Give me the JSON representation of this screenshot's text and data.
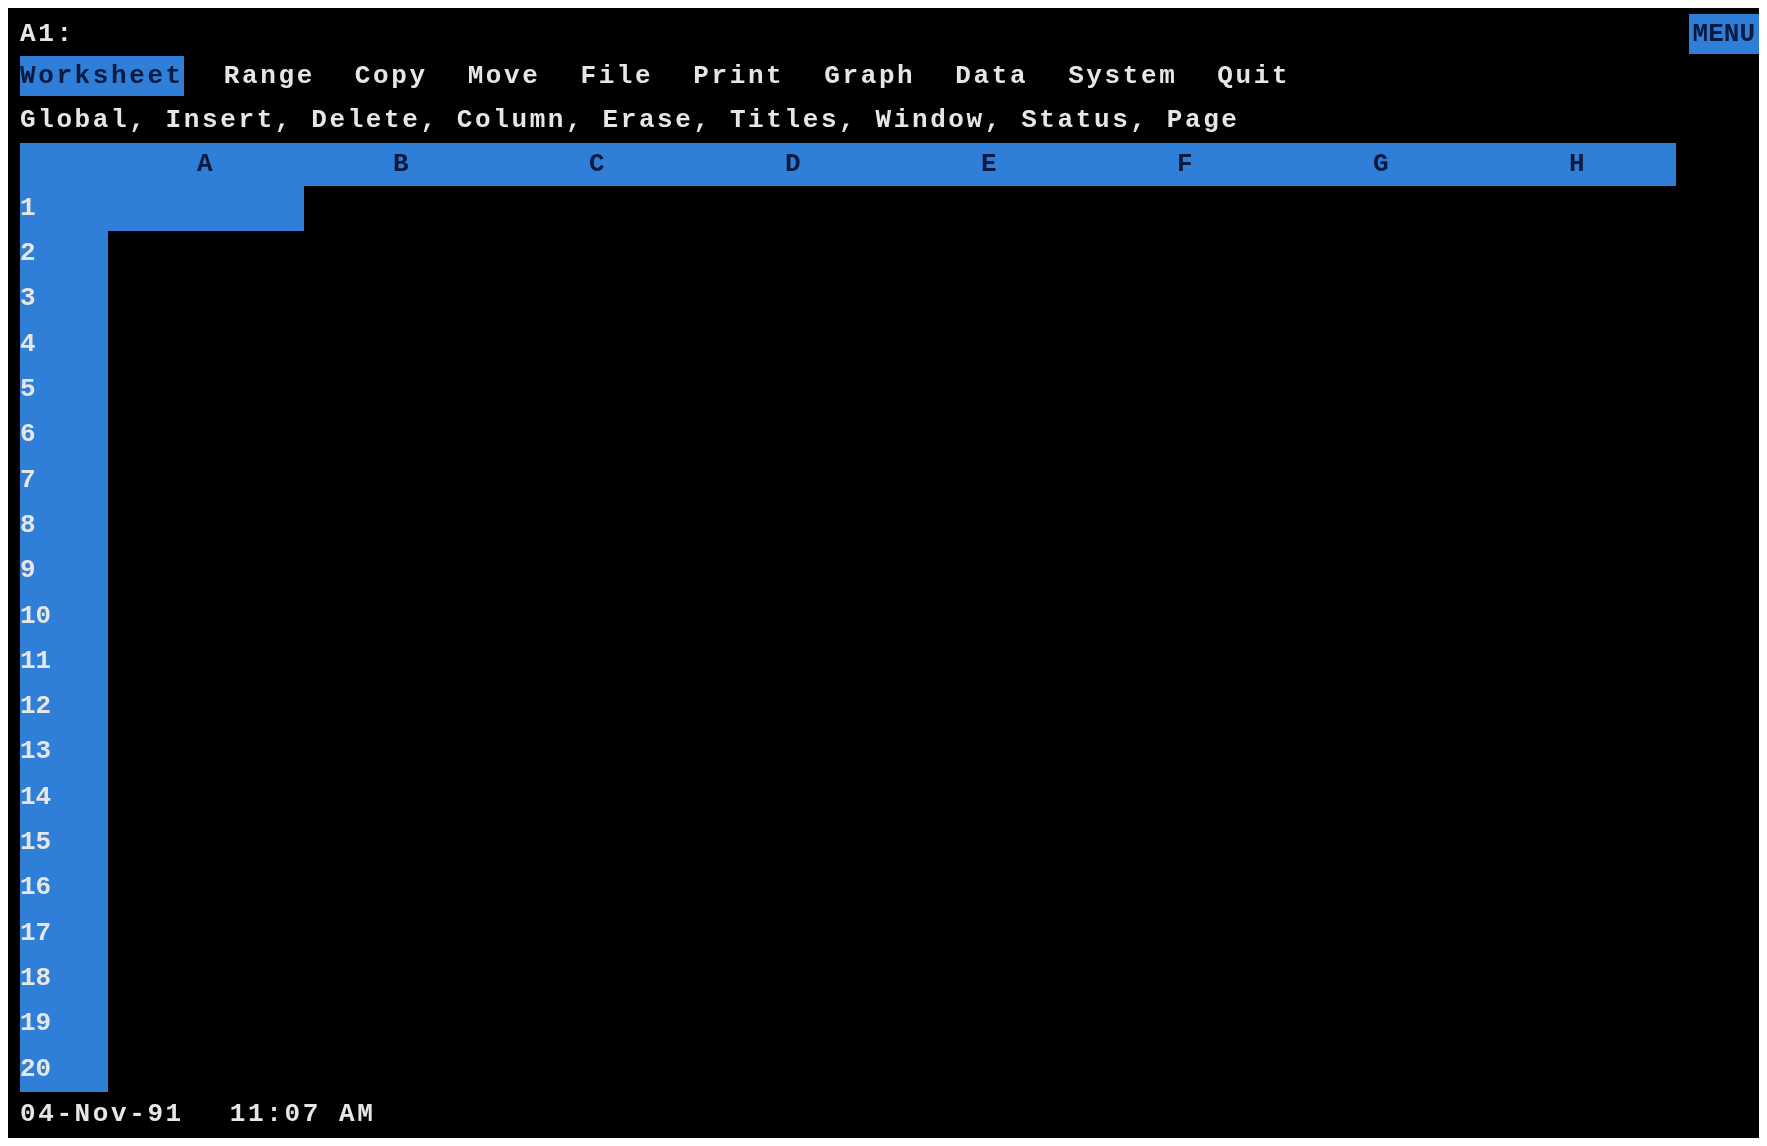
{
  "cell_indicator": "A1:",
  "mode_indicator": "MENU",
  "menu": [
    {
      "label": "Worksheet",
      "selected": true
    },
    {
      "label": "Range",
      "selected": false
    },
    {
      "label": "Copy",
      "selected": false
    },
    {
      "label": "Move",
      "selected": false
    },
    {
      "label": "File",
      "selected": false
    },
    {
      "label": "Print",
      "selected": false
    },
    {
      "label": "Graph",
      "selected": false
    },
    {
      "label": "Data",
      "selected": false
    },
    {
      "label": "System",
      "selected": false
    },
    {
      "label": "Quit",
      "selected": false
    }
  ],
  "menu_description": "Global, Insert, Delete, Column, Erase, Titles, Window, Status, Page",
  "columns": [
    "A",
    "B",
    "C",
    "D",
    "E",
    "F",
    "G",
    "H"
  ],
  "rows": [
    {
      "label": "1",
      "cells": [
        {
          "selected": true
        },
        {
          "selected": false
        },
        {
          "selected": false
        },
        {
          "selected": false
        },
        {
          "selected": false
        },
        {
          "selected": false
        },
        {
          "selected": false
        },
        {
          "selected": false
        }
      ]
    },
    {
      "label": "2",
      "cells": [
        {
          "selected": false
        },
        {
          "selected": false
        },
        {
          "selected": false
        },
        {
          "selected": false
        },
        {
          "selected": false
        },
        {
          "selected": false
        },
        {
          "selected": false
        },
        {
          "selected": false
        }
      ]
    },
    {
      "label": "3",
      "cells": [
        {
          "selected": false
        },
        {
          "selected": false
        },
        {
          "selected": false
        },
        {
          "selected": false
        },
        {
          "selected": false
        },
        {
          "selected": false
        },
        {
          "selected": false
        },
        {
          "selected": false
        }
      ]
    },
    {
      "label": "4",
      "cells": [
        {
          "selected": false
        },
        {
          "selected": false
        },
        {
          "selected": false
        },
        {
          "selected": false
        },
        {
          "selected": false
        },
        {
          "selected": false
        },
        {
          "selected": false
        },
        {
          "selected": false
        }
      ]
    },
    {
      "label": "5",
      "cells": [
        {
          "selected": false
        },
        {
          "selected": false
        },
        {
          "selected": false
        },
        {
          "selected": false
        },
        {
          "selected": false
        },
        {
          "selected": false
        },
        {
          "selected": false
        },
        {
          "selected": false
        }
      ]
    },
    {
      "label": "6",
      "cells": [
        {
          "selected": false
        },
        {
          "selected": false
        },
        {
          "selected": false
        },
        {
          "selected": false
        },
        {
          "selected": false
        },
        {
          "selected": false
        },
        {
          "selected": false
        },
        {
          "selected": false
        }
      ]
    },
    {
      "label": "7",
      "cells": [
        {
          "selected": false
        },
        {
          "selected": false
        },
        {
          "selected": false
        },
        {
          "selected": false
        },
        {
          "selected": false
        },
        {
          "selected": false
        },
        {
          "selected": false
        },
        {
          "selected": false
        }
      ]
    },
    {
      "label": "8",
      "cells": [
        {
          "selected": false
        },
        {
          "selected": false
        },
        {
          "selected": false
        },
        {
          "selected": false
        },
        {
          "selected": false
        },
        {
          "selected": false
        },
        {
          "selected": false
        },
        {
          "selected": false
        }
      ]
    },
    {
      "label": "9",
      "cells": [
        {
          "selected": false
        },
        {
          "selected": false
        },
        {
          "selected": false
        },
        {
          "selected": false
        },
        {
          "selected": false
        },
        {
          "selected": false
        },
        {
          "selected": false
        },
        {
          "selected": false
        }
      ]
    },
    {
      "label": "10",
      "cells": [
        {
          "selected": false
        },
        {
          "selected": false
        },
        {
          "selected": false
        },
        {
          "selected": false
        },
        {
          "selected": false
        },
        {
          "selected": false
        },
        {
          "selected": false
        },
        {
          "selected": false
        }
      ]
    },
    {
      "label": "11",
      "cells": [
        {
          "selected": false
        },
        {
          "selected": false
        },
        {
          "selected": false
        },
        {
          "selected": false
        },
        {
          "selected": false
        },
        {
          "selected": false
        },
        {
          "selected": false
        },
        {
          "selected": false
        }
      ]
    },
    {
      "label": "12",
      "cells": [
        {
          "selected": false
        },
        {
          "selected": false
        },
        {
          "selected": false
        },
        {
          "selected": false
        },
        {
          "selected": false
        },
        {
          "selected": false
        },
        {
          "selected": false
        },
        {
          "selected": false
        }
      ]
    },
    {
      "label": "13",
      "cells": [
        {
          "selected": false
        },
        {
          "selected": false
        },
        {
          "selected": false
        },
        {
          "selected": false
        },
        {
          "selected": false
        },
        {
          "selected": false
        },
        {
          "selected": false
        },
        {
          "selected": false
        }
      ]
    },
    {
      "label": "14",
      "cells": [
        {
          "selected": false
        },
        {
          "selected": false
        },
        {
          "selected": false
        },
        {
          "selected": false
        },
        {
          "selected": false
        },
        {
          "selected": false
        },
        {
          "selected": false
        },
        {
          "selected": false
        }
      ]
    },
    {
      "label": "15",
      "cells": [
        {
          "selected": false
        },
        {
          "selected": false
        },
        {
          "selected": false
        },
        {
          "selected": false
        },
        {
          "selected": false
        },
        {
          "selected": false
        },
        {
          "selected": false
        },
        {
          "selected": false
        }
      ]
    },
    {
      "label": "16",
      "cells": [
        {
          "selected": false
        },
        {
          "selected": false
        },
        {
          "selected": false
        },
        {
          "selected": false
        },
        {
          "selected": false
        },
        {
          "selected": false
        },
        {
          "selected": false
        },
        {
          "selected": false
        }
      ]
    },
    {
      "label": "17",
      "cells": [
        {
          "selected": false
        },
        {
          "selected": false
        },
        {
          "selected": false
        },
        {
          "selected": false
        },
        {
          "selected": false
        },
        {
          "selected": false
        },
        {
          "selected": false
        },
        {
          "selected": false
        }
      ]
    },
    {
      "label": "18",
      "cells": [
        {
          "selected": false
        },
        {
          "selected": false
        },
        {
          "selected": false
        },
        {
          "selected": false
        },
        {
          "selected": false
        },
        {
          "selected": false
        },
        {
          "selected": false
        },
        {
          "selected": false
        }
      ]
    },
    {
      "label": "19",
      "cells": [
        {
          "selected": false
        },
        {
          "selected": false
        },
        {
          "selected": false
        },
        {
          "selected": false
        },
        {
          "selected": false
        },
        {
          "selected": false
        },
        {
          "selected": false
        },
        {
          "selected": false
        }
      ]
    },
    {
      "label": "20",
      "cells": [
        {
          "selected": false
        },
        {
          "selected": false
        },
        {
          "selected": false
        },
        {
          "selected": false
        },
        {
          "selected": false
        },
        {
          "selected": false
        },
        {
          "selected": false
        },
        {
          "selected": false
        }
      ]
    }
  ],
  "status_bar": {
    "date": "04-Nov-91",
    "time": "11:07 AM"
  }
}
